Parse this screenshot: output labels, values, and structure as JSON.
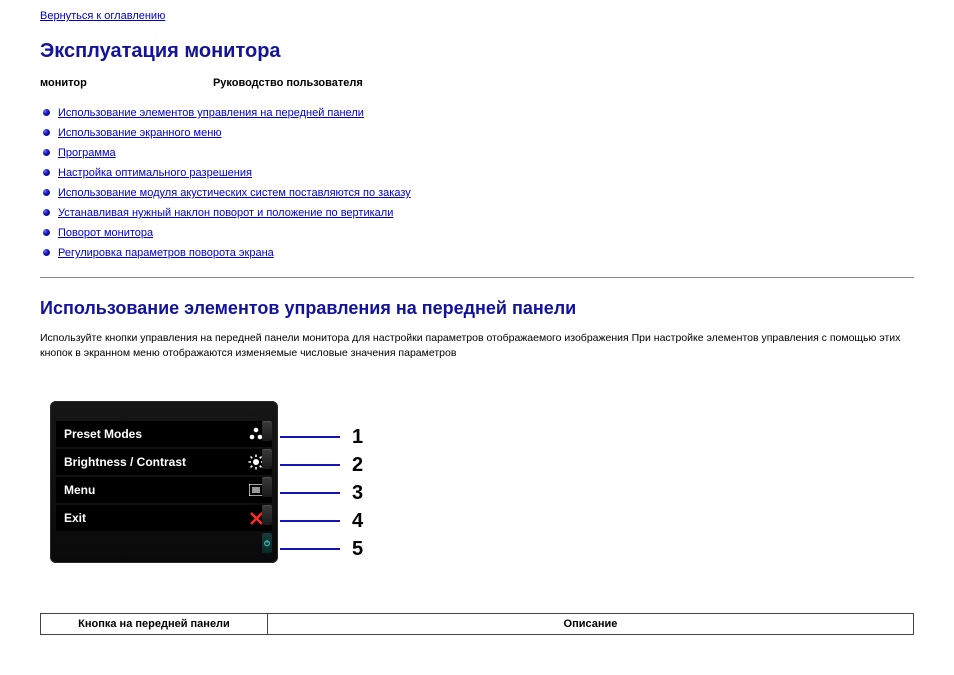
{
  "nav": {
    "back": "Вернуться к оглавлению"
  },
  "title": "Эксплуатация монитора",
  "subtitle": {
    "left": "монитор",
    "right": "Руководство пользователя"
  },
  "toc": [
    "Использование элементов управления на передней панели",
    "Использование экранного меню",
    "Программа",
    "Настройка оптимального разрешения",
    "Использование модуля акустических систем                     поставляются по заказу",
    "Устанавливая нужный наклон  поворот и положение по вертикали",
    " Поворот монитора",
    " Регулировка параметров поворота экрана"
  ],
  "section": {
    "heading": "Использование элементов управления на передней панели",
    "body": "Используйте кнопки управления на передней панели монитора для настройки параметров отображаемого изображения  При настройке элементов управления с помощью этих кнопок в экранном меню отображаются изменяемые числовые значения параметров"
  },
  "osd": {
    "items": [
      "Preset Modes",
      "Brightness / Contrast",
      "Menu",
      "Exit"
    ]
  },
  "callouts": [
    "1",
    "2",
    "3",
    "4",
    "5"
  ],
  "table": {
    "col1": "Кнопка на передней панели",
    "col2": "Описание"
  }
}
